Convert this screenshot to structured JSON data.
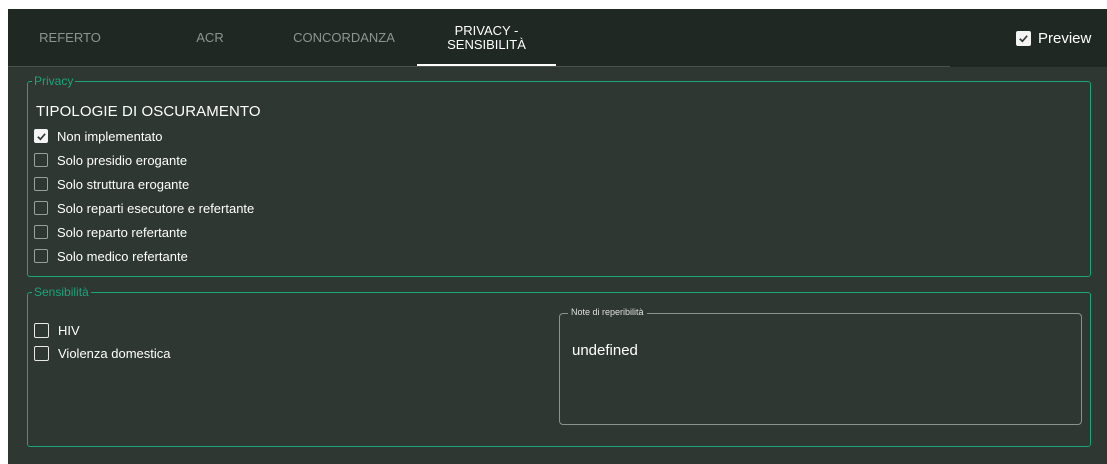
{
  "tabs": [
    {
      "label": "REFERTO",
      "active": false
    },
    {
      "label": "ACR",
      "active": false
    },
    {
      "label": "CONCORDANZA",
      "active": false
    },
    {
      "label": "PRIVACY - SENSIBILITÀ",
      "active": true
    }
  ],
  "preview": {
    "label": "Preview",
    "checked": true
  },
  "privacy": {
    "legend": "Privacy",
    "heading": "TIPOLOGIE DI OSCURAMENTO",
    "options": [
      {
        "label": "Non implementato",
        "checked": true
      },
      {
        "label": "Solo presidio erogante",
        "checked": false
      },
      {
        "label": "Solo struttura erogante",
        "checked": false
      },
      {
        "label": "Solo reparti esecutore e refertante",
        "checked": false
      },
      {
        "label": "Solo reparto refertante",
        "checked": false
      },
      {
        "label": "Solo medico refertante",
        "checked": false
      }
    ]
  },
  "sensibilita": {
    "legend": "Sensibilità",
    "options": [
      {
        "label": "HIV",
        "checked": false
      },
      {
        "label": "Violenza domestica",
        "checked": false
      }
    ],
    "note": {
      "label": "Note di reperibilità",
      "value": "undefined"
    }
  },
  "colors": {
    "background": "#2e3731",
    "topbar": "#1f2822",
    "accent": "#1aa57b",
    "inactive_tab": "#8e958f"
  }
}
